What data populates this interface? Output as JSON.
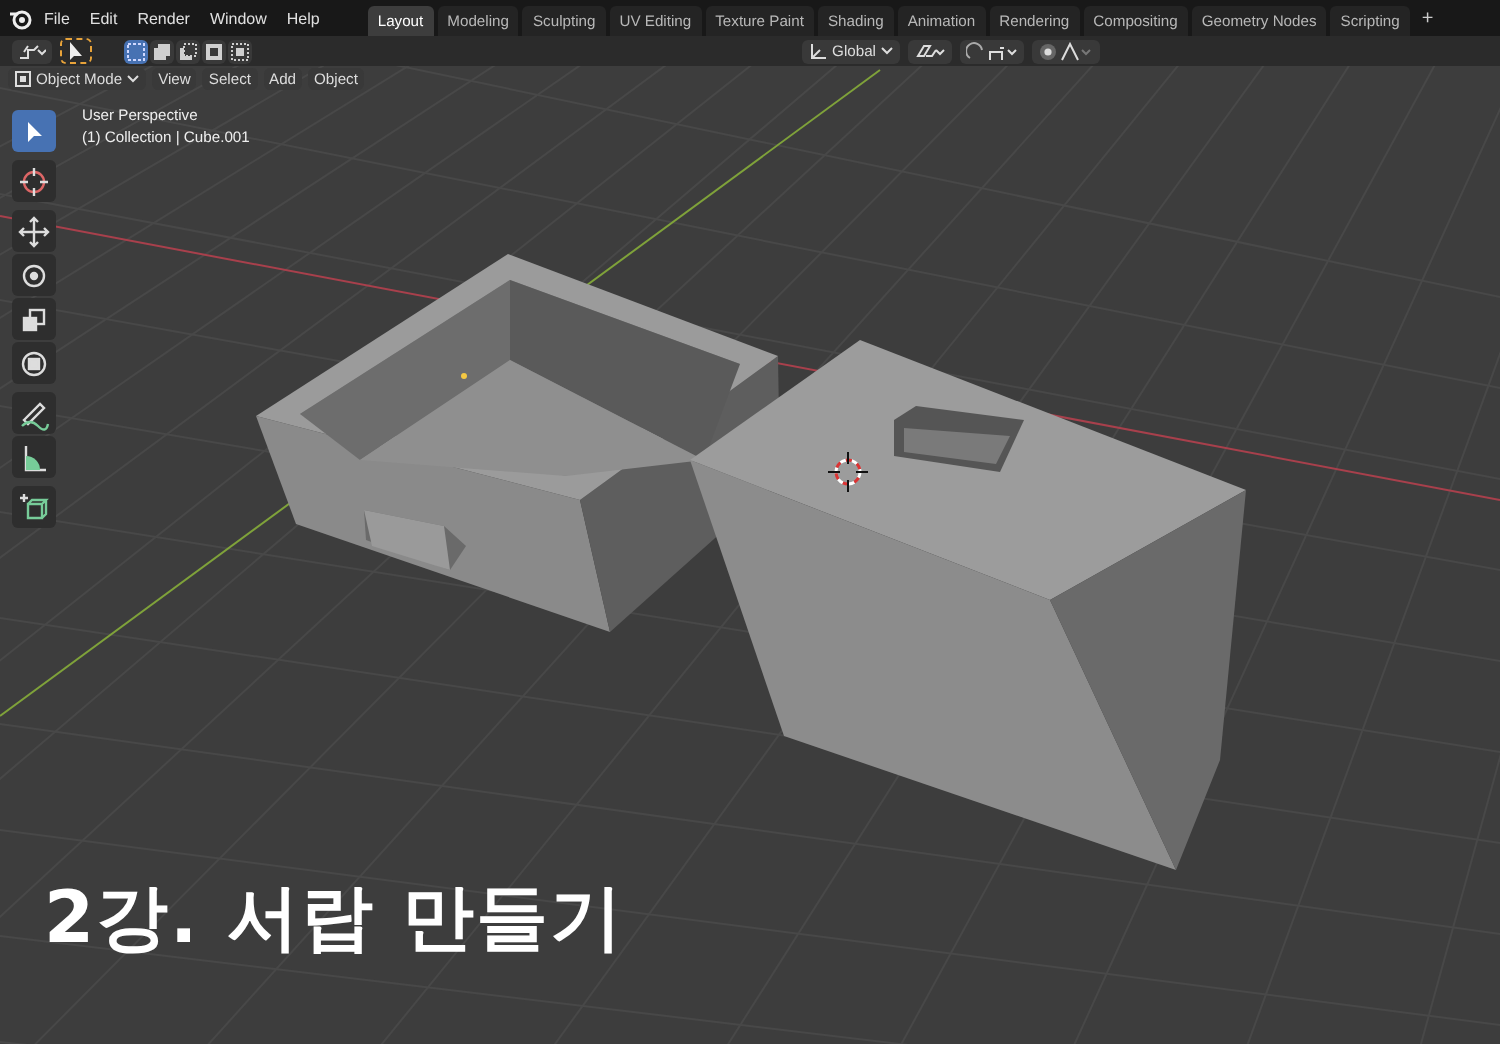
{
  "menu": [
    "File",
    "Edit",
    "Render",
    "Window",
    "Help"
  ],
  "workspace_tabs": [
    {
      "label": "Layout",
      "selected": true
    },
    {
      "label": "Modeling",
      "selected": false
    },
    {
      "label": "Sculpting",
      "selected": false
    },
    {
      "label": "UV Editing",
      "selected": false
    },
    {
      "label": "Texture Paint",
      "selected": false
    },
    {
      "label": "Shading",
      "selected": false
    },
    {
      "label": "Animation",
      "selected": false
    },
    {
      "label": "Rendering",
      "selected": false
    },
    {
      "label": "Compositing",
      "selected": false
    },
    {
      "label": "Geometry Nodes",
      "selected": false
    },
    {
      "label": "Scripting",
      "selected": false
    }
  ],
  "add_tab": "+",
  "select_modes": [
    {
      "kind": "set",
      "selected": true
    },
    {
      "kind": "extend",
      "selected": false
    },
    {
      "kind": "subtract",
      "selected": false
    },
    {
      "kind": "invert",
      "selected": false
    },
    {
      "kind": "intersect",
      "selected": false
    }
  ],
  "transform_orientation": "Global",
  "viewport_header": {
    "mode": "Object Mode",
    "menus": [
      "View",
      "Select",
      "Add",
      "Object"
    ]
  },
  "tools": [
    {
      "kind": "select",
      "selected": true
    },
    {
      "kind": "cursor",
      "selected": false
    },
    {
      "kind": "move",
      "selected": false
    },
    {
      "kind": "rotate",
      "selected": false
    },
    {
      "kind": "scale",
      "selected": false
    },
    {
      "kind": "transform",
      "selected": false
    },
    {
      "kind": "annotate",
      "selected": false
    },
    {
      "kind": "measure",
      "selected": false
    },
    {
      "kind": "add-cube",
      "selected": false
    }
  ],
  "overlay": {
    "view_name": "User Perspective",
    "collection": "(1) Collection | Cube.001"
  },
  "caption": "2강. 서랍 만들기"
}
